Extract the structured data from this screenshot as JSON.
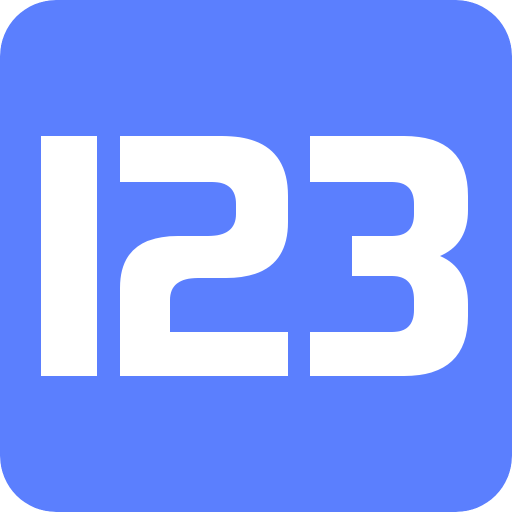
{
  "icon": {
    "name": "123-logo-icon",
    "text": "123",
    "background_color": "#5B7FFE",
    "glyph_color": "#FFFFFF"
  }
}
